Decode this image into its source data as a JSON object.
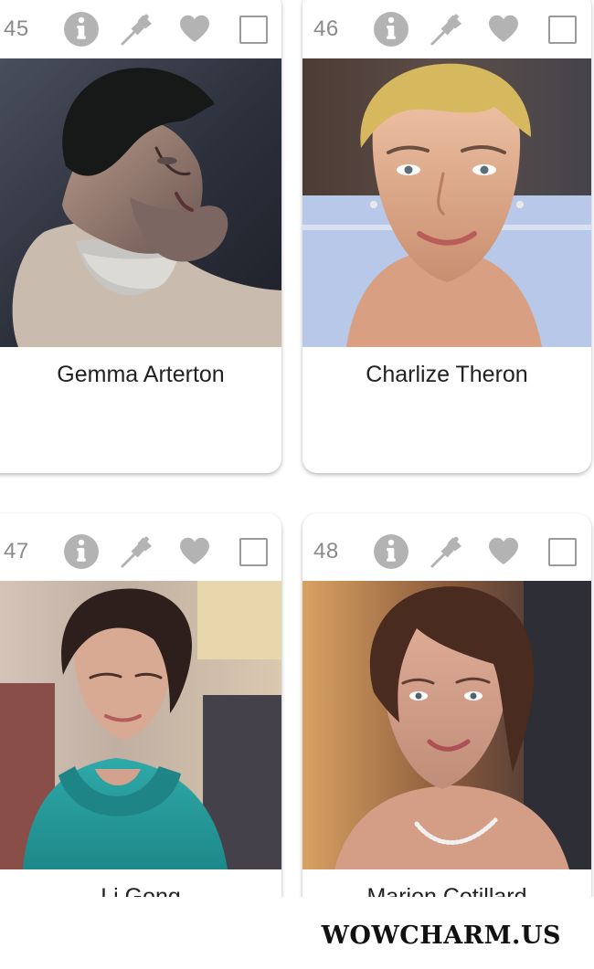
{
  "cards": [
    {
      "rank": "45",
      "name": "Gemma Arterton",
      "icons": [
        "info-icon",
        "pin-icon",
        "heart-icon",
        "checkbox"
      ]
    },
    {
      "rank": "46",
      "name": "Charlize Theron",
      "icons": [
        "info-icon",
        "pin-icon",
        "heart-icon",
        "checkbox"
      ]
    },
    {
      "rank": "47",
      "name": "Li Gong",
      "icons": [
        "info-icon",
        "pin-icon",
        "heart-icon",
        "checkbox"
      ]
    },
    {
      "rank": "48",
      "name": "Marion Cotillard",
      "icons": [
        "info-icon",
        "pin-icon",
        "heart-icon",
        "checkbox"
      ]
    }
  ],
  "watermark": "WOWCHARM.US",
  "colors": {
    "icon": "#b3b3b3",
    "rank": "#8a8a8a",
    "name": "#222222",
    "card": "#ffffff"
  }
}
